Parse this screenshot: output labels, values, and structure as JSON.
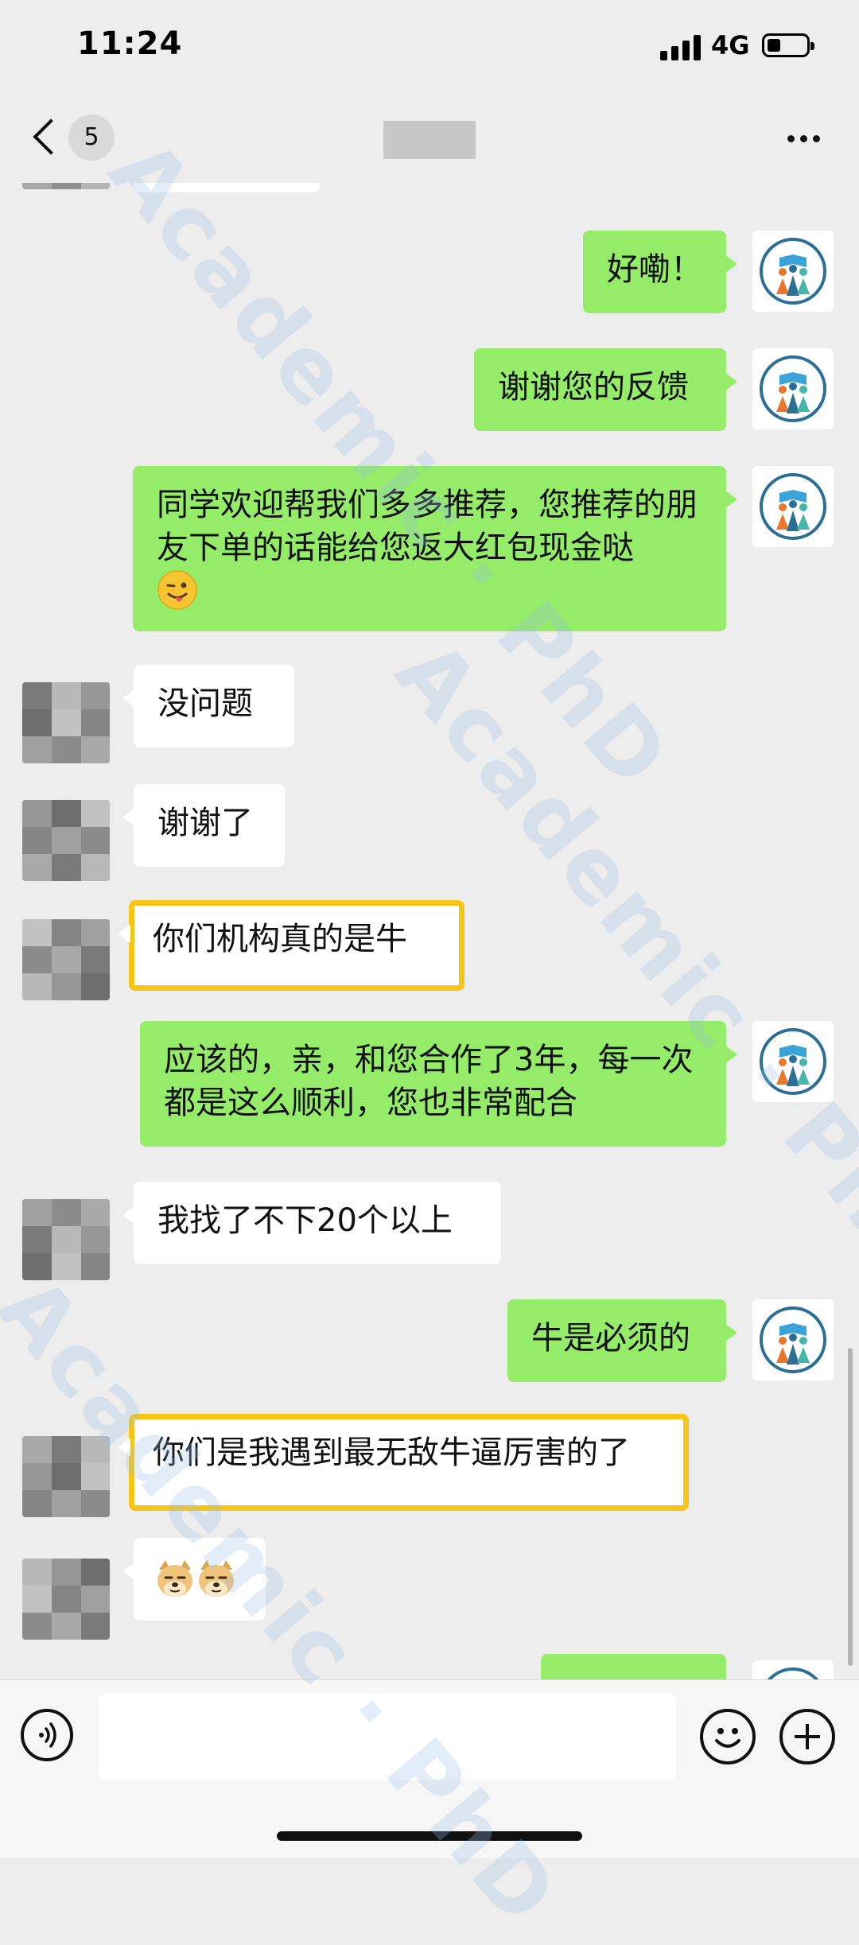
{
  "status_bar": {
    "time": "11:24",
    "network": "4G",
    "battery_level": 0.25
  },
  "nav": {
    "unread_count": "5"
  },
  "messages": [
    {
      "sender": "me",
      "text": "好嘞！"
    },
    {
      "sender": "me",
      "text": "谢谢您的反馈"
    },
    {
      "sender": "me",
      "text": "同学欢迎帮我们多多推荐，您推荐的朋友下单的话能给您返大红包现金哒",
      "emoji": "winking-tongue"
    },
    {
      "sender": "them",
      "text": "没问题"
    },
    {
      "sender": "them",
      "text": "谢谢了"
    },
    {
      "sender": "them",
      "text": "你们机构真的是牛",
      "highlighted": true
    },
    {
      "sender": "me",
      "text": "应该的，亲，和您合作了3年，每一次都是这么顺利，您也非常配合"
    },
    {
      "sender": "them",
      "text": "我找了不下20个以上"
    },
    {
      "sender": "me",
      "text": "牛是必须的"
    },
    {
      "sender": "them",
      "text": "你们是我遇到最无敌牛逼厉害的了",
      "highlighted": true
    },
    {
      "sender": "them",
      "text": "",
      "emoji": "doge-doge"
    }
  ],
  "input_bar": {
    "placeholder": ""
  },
  "watermark": {
    "text": "Academic · PhD"
  },
  "colors": {
    "my_bubble": "#95ec69",
    "their_bubble": "#ffffff",
    "highlight_border": "#f5c518",
    "background": "#ededed"
  },
  "icons": [
    "back-icon",
    "more-icon",
    "voice-icon",
    "emoji-icon",
    "plus-icon"
  ]
}
